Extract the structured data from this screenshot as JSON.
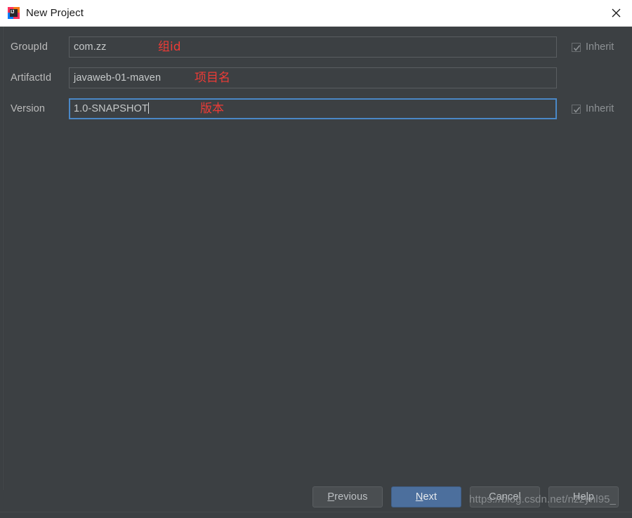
{
  "window": {
    "title": "New Project",
    "icon": "intellij-idea-icon",
    "close_icon": "close-icon",
    "background_color": "#3c4043",
    "titlebar_color": "#ffffff"
  },
  "form": {
    "rows": [
      {
        "label": "GroupId",
        "value": "com.zz",
        "annotation": "组id",
        "focused": false,
        "has_inherit": true,
        "inherit_label": "Inherit",
        "inherit_checked": true,
        "inherit_enabled": false
      },
      {
        "label": "ArtifactId",
        "value": "javaweb-01-maven",
        "annotation": "项目名",
        "focused": false,
        "has_inherit": false,
        "inherit_label": "",
        "inherit_checked": false,
        "inherit_enabled": false
      },
      {
        "label": "Version",
        "value": "1.0-SNAPSHOT",
        "annotation": "版本",
        "focused": true,
        "has_inherit": true,
        "inherit_label": "Inherit",
        "inherit_checked": true,
        "inherit_enabled": false
      }
    ],
    "annotation_color": "#ee3b36"
  },
  "buttons": {
    "previous": {
      "label_before": "",
      "mnemonic": "P",
      "label_after": "revious",
      "primary": false
    },
    "next": {
      "label_before": "",
      "mnemonic": "N",
      "label_after": "ext",
      "primary": true
    },
    "cancel": {
      "label_before": "Cancel",
      "mnemonic": "",
      "label_after": "",
      "primary": false
    },
    "help": {
      "label_before": "Help",
      "mnemonic": "",
      "label_after": "",
      "primary": false
    },
    "primary_color": "#4c6f9d"
  },
  "watermark": {
    "text": "https://blog.csdn.net/nzzynl95_"
  },
  "bottom_sliver": {
    "ghost_text": ""
  }
}
